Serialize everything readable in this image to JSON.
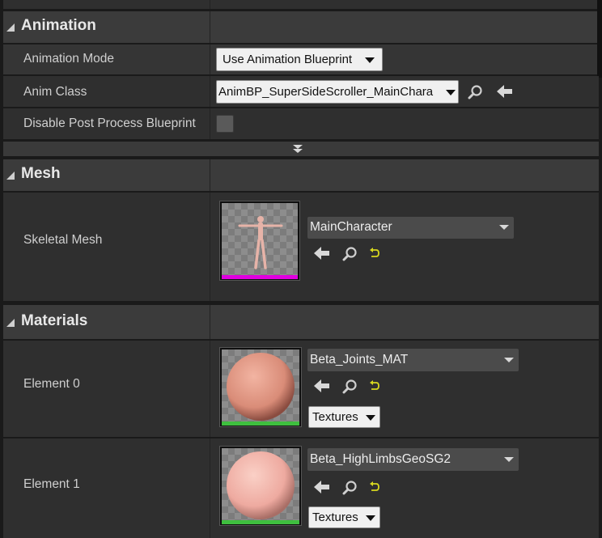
{
  "animation": {
    "title": "Animation",
    "mode_label": "Animation Mode",
    "mode_value": "Use Animation Blueprint",
    "anim_class_label": "Anim Class",
    "anim_class_value": "AnimBP_SuperSideScroller_MainChara",
    "disable_pp_label": "Disable Post Process Blueprint",
    "disable_pp_checked": false
  },
  "mesh": {
    "title": "Mesh",
    "skeletal_label": "Skeletal Mesh",
    "skeletal_value": "MainCharacter",
    "asset_color": "#e000e0"
  },
  "materials": {
    "title": "Materials",
    "elements": [
      {
        "label": "Element 0",
        "value": "Beta_Joints_MAT",
        "textures_label": "Textures",
        "asset_color": "#3fbf3f"
      },
      {
        "label": "Element 1",
        "value": "Beta_HighLimbsGeoSG2",
        "textures_label": "Textures",
        "asset_color": "#3fbf3f"
      }
    ]
  },
  "icons": [
    "collapse-triangle-icon",
    "dropdown-arrow-icon",
    "search-icon",
    "use-selected-arrow-icon",
    "reset-to-default-icon",
    "expand-advanced-icon"
  ]
}
